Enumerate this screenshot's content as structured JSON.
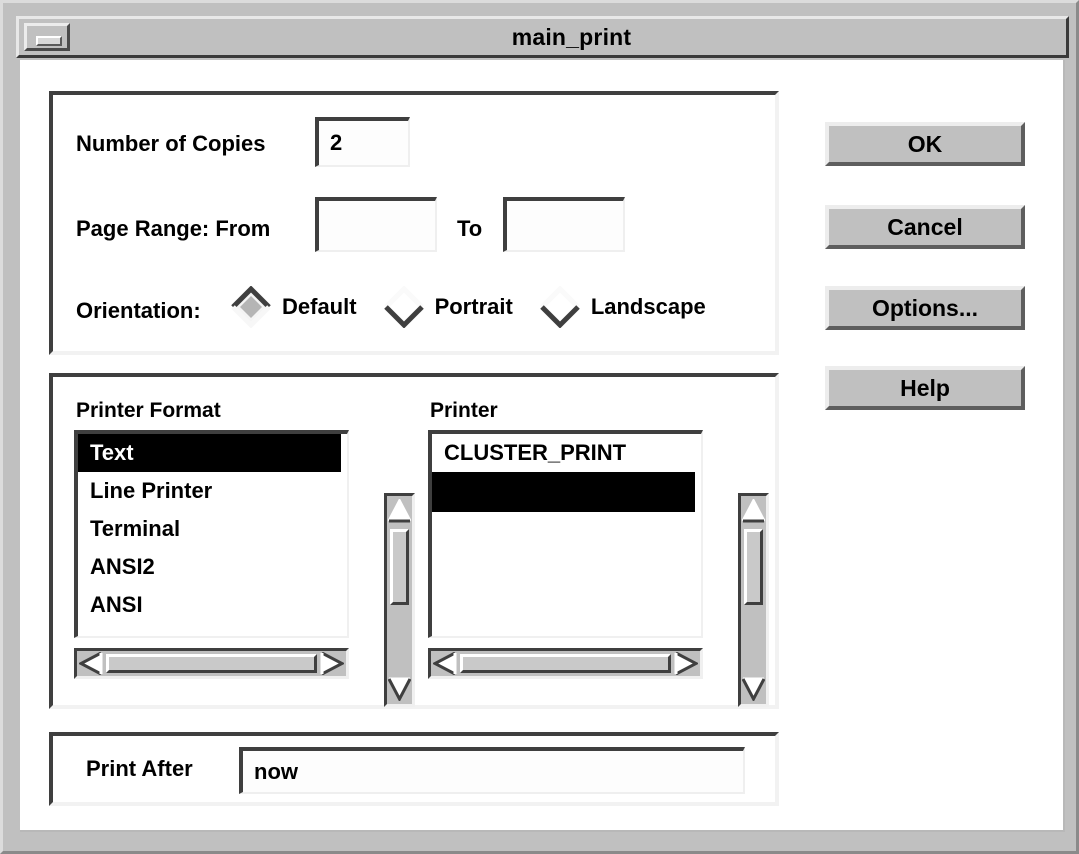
{
  "window": {
    "title": "main_print",
    "minimize_icon": "minimize-icon"
  },
  "print_options": {
    "copies_label": "Number of Copies",
    "copies_value": "2",
    "page_range_label": "Page Range: From",
    "page_from_value": "",
    "page_to_label": "To",
    "page_to_value": "",
    "orientation_label": "Orientation:",
    "orientation_options": [
      {
        "label": "Default",
        "selected": true
      },
      {
        "label": "Portrait",
        "selected": false
      },
      {
        "label": "Landscape",
        "selected": false
      }
    ]
  },
  "buttons": {
    "ok": "OK",
    "cancel": "Cancel",
    "options": "Options...",
    "help": "Help"
  },
  "printer_format": {
    "title": "Printer Format",
    "items": [
      {
        "label": "Text",
        "selected": true
      },
      {
        "label": "Line Printer",
        "selected": false
      },
      {
        "label": "Terminal",
        "selected": false
      },
      {
        "label": "ANSI2",
        "selected": false
      },
      {
        "label": "ANSI",
        "selected": false
      }
    ]
  },
  "printer": {
    "title": "Printer",
    "items": [
      {
        "label": "CLUSTER_PRINT",
        "selected": false
      },
      {
        "label": "",
        "selected": true
      }
    ]
  },
  "print_after": {
    "label": "Print After",
    "value": "now"
  },
  "icons": {
    "scroll_up": "triangle-up-icon",
    "scroll_down": "triangle-down-icon",
    "scroll_left": "triangle-left-icon",
    "scroll_right": "triangle-right-icon"
  },
  "colors": {
    "face": "#c0c0c0",
    "body": "#ffffff",
    "shadow": "#3f3f3f",
    "highlight": "#f0f0f0",
    "selection": "#000000",
    "selection_text": "#ffffff"
  }
}
